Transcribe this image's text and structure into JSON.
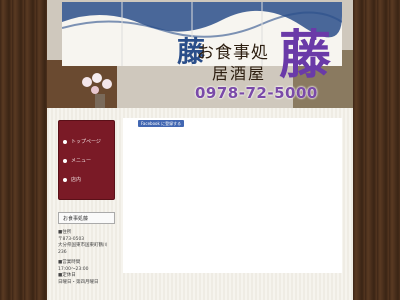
{
  "header": {
    "small_kanji": "藤",
    "title_line1": "お食事処",
    "title_line2": "居酒屋",
    "big_kanji": "藤",
    "phone": "0978-72-5000"
  },
  "nav": {
    "items": [
      {
        "label": "トップページ"
      },
      {
        "label": "メニュー"
      },
      {
        "label": "店内"
      }
    ]
  },
  "sidebar": {
    "section_title": "お食事処藤",
    "address_label": "■住所",
    "postal": "〒873-0503",
    "address": "大分県国東市国東町鶴川",
    "address2": "236",
    "hours_label": "■営業時間",
    "hours": "17:00～23:00",
    "holiday_label": "■定休日",
    "holiday": "日曜日・第四月曜日"
  },
  "main": {
    "facebook_button": "Facebook に登録する"
  },
  "colors": {
    "nav_bg": "#7a1a26",
    "accent_purple": "#6a3aa8",
    "wood": "#4a2f1c"
  }
}
